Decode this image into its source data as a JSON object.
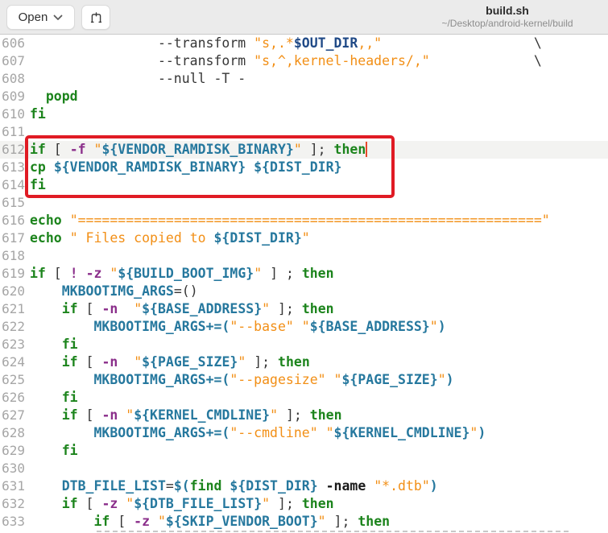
{
  "header": {
    "open_label": "Open",
    "title": "build.sh",
    "subtitle": "~/Desktop/android-kernel/build"
  },
  "colors": {
    "header_bg": "#ebebeb",
    "annotation_red": "#e01b24",
    "keyword_green": "#1c841c",
    "variable_teal": "#26789e",
    "variable_navy": "#204a87",
    "string_orange": "#f28f16",
    "option_purple": "#8b2f8b",
    "caret_orange": "#e8492c",
    "current_line_bg": "#f3f3f1",
    "line_number_gray": "#a6a6a6"
  },
  "editor": {
    "language": "shell-script",
    "current_line": 612,
    "caret_line": 612,
    "annotation_lines": "612-614",
    "lines": [
      {
        "n": 606,
        "t": [
          [
            "p",
            "                --transform "
          ],
          [
            "s",
            "\"s,.*"
          ],
          [
            "n",
            "$OUT_DIR"
          ],
          [
            "s",
            ",,\""
          ],
          [
            "p",
            "                   \\"
          ]
        ]
      },
      {
        "n": 607,
        "t": [
          [
            "p",
            "                --transform "
          ],
          [
            "s",
            "\"s,^,kernel-headers/,\""
          ],
          [
            "p",
            "             \\"
          ]
        ]
      },
      {
        "n": 608,
        "t": [
          [
            "p",
            "                --null -T -"
          ]
        ]
      },
      {
        "n": 609,
        "t": [
          [
            "p",
            "  "
          ],
          [
            "k",
            "popd"
          ]
        ]
      },
      {
        "n": 610,
        "t": [
          [
            "k",
            "fi"
          ]
        ]
      },
      {
        "n": 611,
        "t": []
      },
      {
        "n": 612,
        "t": [
          [
            "k",
            "if"
          ],
          [
            "p",
            " [ "
          ],
          [
            "o",
            "-f"
          ],
          [
            "p",
            " "
          ],
          [
            "s",
            "\""
          ],
          [
            "v",
            "${VENDOR_RAMDISK_BINARY}"
          ],
          [
            "s",
            "\""
          ],
          [
            "p",
            " ]; "
          ],
          [
            "k",
            "then"
          ]
        ]
      },
      {
        "n": 613,
        "t": [
          [
            "k",
            "cp"
          ],
          [
            "p",
            " "
          ],
          [
            "v",
            "${VENDOR_RAMDISK_BINARY}"
          ],
          [
            "p",
            " "
          ],
          [
            "v",
            "${DIST_DIR}"
          ]
        ]
      },
      {
        "n": 614,
        "t": [
          [
            "k",
            "fi"
          ]
        ]
      },
      {
        "n": 615,
        "t": []
      },
      {
        "n": 616,
        "t": [
          [
            "k",
            "echo"
          ],
          [
            "p",
            " "
          ],
          [
            "s",
            "\"==========================================================\""
          ]
        ]
      },
      {
        "n": 617,
        "t": [
          [
            "k",
            "echo"
          ],
          [
            "p",
            " "
          ],
          [
            "s",
            "\" Files copied to "
          ],
          [
            "v",
            "${DIST_DIR}"
          ],
          [
            "s",
            "\""
          ]
        ]
      },
      {
        "n": 618,
        "t": []
      },
      {
        "n": 619,
        "t": [
          [
            "k",
            "if"
          ],
          [
            "p",
            " [ "
          ],
          [
            "o",
            "!"
          ],
          [
            "p",
            " "
          ],
          [
            "o",
            "-z"
          ],
          [
            "p",
            " "
          ],
          [
            "s",
            "\""
          ],
          [
            "v",
            "${BUILD_BOOT_IMG}"
          ],
          [
            "s",
            "\""
          ],
          [
            "p",
            " ] ; "
          ],
          [
            "k",
            "then"
          ]
        ]
      },
      {
        "n": 620,
        "t": [
          [
            "p",
            "    "
          ],
          [
            "v",
            "MKBOOTIMG_ARGS"
          ],
          [
            "p",
            "=()"
          ]
        ]
      },
      {
        "n": 621,
        "t": [
          [
            "p",
            "    "
          ],
          [
            "k",
            "if"
          ],
          [
            "p",
            " [ "
          ],
          [
            "o",
            "-n"
          ],
          [
            "p",
            "  "
          ],
          [
            "s",
            "\""
          ],
          [
            "v",
            "${BASE_ADDRESS}"
          ],
          [
            "s",
            "\""
          ],
          [
            "p",
            " ]; "
          ],
          [
            "k",
            "then"
          ]
        ]
      },
      {
        "n": 622,
        "t": [
          [
            "p",
            "        "
          ],
          [
            "v",
            "MKBOOTIMG_ARGS"
          ],
          [
            "t",
            "+=("
          ],
          [
            "s",
            "\"--base\""
          ],
          [
            "p",
            " "
          ],
          [
            "s",
            "\""
          ],
          [
            "v",
            "${BASE_ADDRESS}"
          ],
          [
            "s",
            "\""
          ],
          [
            "t",
            ")"
          ]
        ]
      },
      {
        "n": 623,
        "t": [
          [
            "p",
            "    "
          ],
          [
            "k",
            "fi"
          ]
        ]
      },
      {
        "n": 624,
        "t": [
          [
            "p",
            "    "
          ],
          [
            "k",
            "if"
          ],
          [
            "p",
            " [ "
          ],
          [
            "o",
            "-n"
          ],
          [
            "p",
            "  "
          ],
          [
            "s",
            "\""
          ],
          [
            "v",
            "${PAGE_SIZE}"
          ],
          [
            "s",
            "\""
          ],
          [
            "p",
            " ]; "
          ],
          [
            "k",
            "then"
          ]
        ]
      },
      {
        "n": 625,
        "t": [
          [
            "p",
            "        "
          ],
          [
            "v",
            "MKBOOTIMG_ARGS"
          ],
          [
            "t",
            "+=("
          ],
          [
            "s",
            "\"--pagesize\""
          ],
          [
            "p",
            " "
          ],
          [
            "s",
            "\""
          ],
          [
            "v",
            "${PAGE_SIZE}"
          ],
          [
            "s",
            "\""
          ],
          [
            "t",
            ")"
          ]
        ]
      },
      {
        "n": 626,
        "t": [
          [
            "p",
            "    "
          ],
          [
            "k",
            "fi"
          ]
        ]
      },
      {
        "n": 627,
        "t": [
          [
            "p",
            "    "
          ],
          [
            "k",
            "if"
          ],
          [
            "p",
            " [ "
          ],
          [
            "o",
            "-n"
          ],
          [
            "p",
            " "
          ],
          [
            "s",
            "\""
          ],
          [
            "v",
            "${KERNEL_CMDLINE}"
          ],
          [
            "s",
            "\""
          ],
          [
            "p",
            " ]; "
          ],
          [
            "k",
            "then"
          ]
        ]
      },
      {
        "n": 628,
        "t": [
          [
            "p",
            "        "
          ],
          [
            "v",
            "MKBOOTIMG_ARGS"
          ],
          [
            "t",
            "+=("
          ],
          [
            "s",
            "\"--cmdline\""
          ],
          [
            "p",
            " "
          ],
          [
            "s",
            "\""
          ],
          [
            "v",
            "${KERNEL_CMDLINE}"
          ],
          [
            "s",
            "\""
          ],
          [
            "t",
            ")"
          ]
        ]
      },
      {
        "n": 629,
        "t": [
          [
            "p",
            "    "
          ],
          [
            "k",
            "fi"
          ]
        ]
      },
      {
        "n": 630,
        "t": []
      },
      {
        "n": 631,
        "t": [
          [
            "p",
            "    "
          ],
          [
            "v",
            "DTB_FILE_LIST"
          ],
          [
            "p",
            "="
          ],
          [
            "t",
            "$("
          ],
          [
            "k",
            "find"
          ],
          [
            "p",
            " "
          ],
          [
            "v",
            "${DIST_DIR}"
          ],
          [
            "p",
            " "
          ],
          [
            "b",
            "-name"
          ],
          [
            "p",
            " "
          ],
          [
            "s",
            "\"*.dtb\""
          ],
          [
            "t",
            ")"
          ]
        ]
      },
      {
        "n": 632,
        "t": [
          [
            "p",
            "    "
          ],
          [
            "k",
            "if"
          ],
          [
            "p",
            " [ "
          ],
          [
            "o",
            "-z"
          ],
          [
            "p",
            " "
          ],
          [
            "s",
            "\""
          ],
          [
            "v",
            "${DTB_FILE_LIST}"
          ],
          [
            "s",
            "\""
          ],
          [
            "p",
            " ]; "
          ],
          [
            "k",
            "then"
          ]
        ]
      },
      {
        "n": 633,
        "t": [
          [
            "p",
            "        "
          ],
          [
            "k",
            "if"
          ],
          [
            "p",
            " [ "
          ],
          [
            "o",
            "-z"
          ],
          [
            "p",
            " "
          ],
          [
            "s",
            "\""
          ],
          [
            "v",
            "${SKIP_VENDOR_BOOT}"
          ],
          [
            "s",
            "\""
          ],
          [
            "p",
            " ]; "
          ],
          [
            "k",
            "then"
          ]
        ]
      }
    ]
  }
}
